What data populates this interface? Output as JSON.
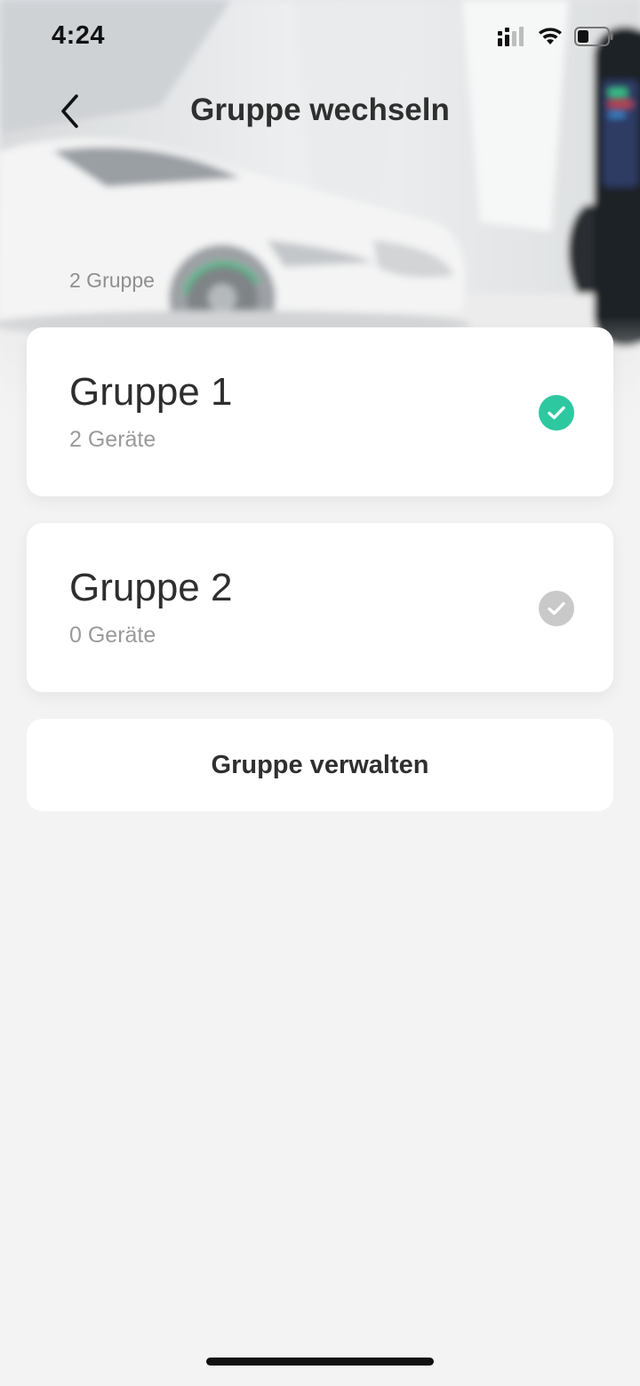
{
  "status_bar": {
    "time": "4:24",
    "icons": [
      "cellular-signal-icon",
      "wifi-icon",
      "battery-icon"
    ]
  },
  "nav": {
    "title": "Gruppe wechseln",
    "back_icon": "chevron-left-icon"
  },
  "summary": {
    "group_count": "2 Gruppe"
  },
  "groups": [
    {
      "name": "Gruppe 1",
      "devices": "2 Geräte",
      "selected": true
    },
    {
      "name": "Gruppe 2",
      "devices": "0 Geräte",
      "selected": false
    }
  ],
  "actions": {
    "manage_label": "Gruppe verwalten"
  },
  "colors": {
    "accent": "#2ec8a0",
    "unselected_check": "#c9c9c9",
    "background": "#f3f3f3",
    "card": "#ffffff",
    "text_primary": "#2f2f2f",
    "text_secondary": "#9a9a9a"
  }
}
